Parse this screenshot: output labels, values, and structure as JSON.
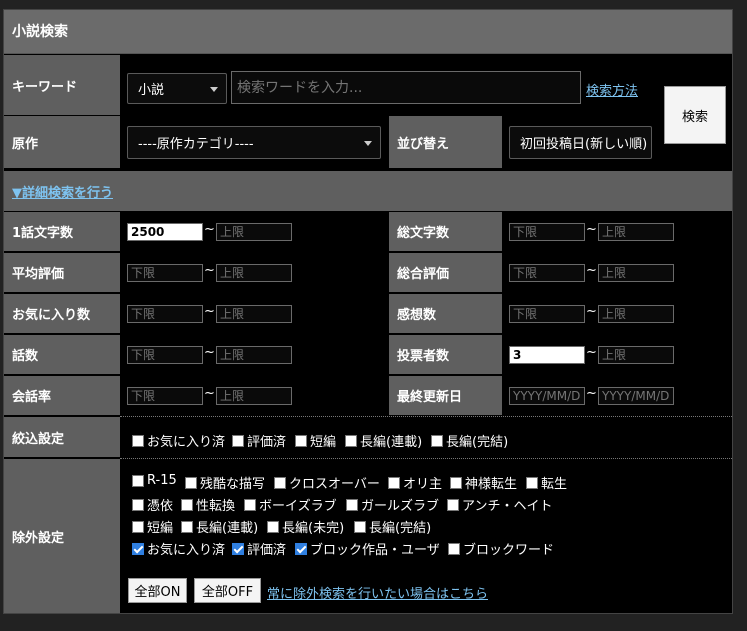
{
  "title": "小説検索",
  "keyword": {
    "label": "キーワード",
    "type_select": "小説",
    "placeholder": "検索ワードを入力...",
    "help_link": "検索方法",
    "search_button": "検索"
  },
  "original": {
    "label": "原作",
    "select": "----原作カテゴリ----"
  },
  "sort": {
    "label": "並び替え",
    "select": "初回投稿日(新しい順)"
  },
  "advanced_toggle": "▼詳細検索を行う",
  "ranges": {
    "tilde": "~",
    "words_per_chapter": {
      "label": "1話文字数",
      "min": "2500",
      "max_placeholder": "上限"
    },
    "total_words": {
      "label": "総文字数",
      "min_placeholder": "下限",
      "max_placeholder": "上限"
    },
    "avg_rating": {
      "label": "平均評価",
      "min_placeholder": "下限",
      "max_placeholder": "上限"
    },
    "total_rating": {
      "label": "総合評価",
      "min_placeholder": "下限",
      "max_placeholder": "上限"
    },
    "favorites": {
      "label": "お気に入り数",
      "min_placeholder": "下限",
      "max_placeholder": "上限"
    },
    "reviews": {
      "label": "感想数",
      "min_placeholder": "下限",
      "max_placeholder": "上限"
    },
    "chapters": {
      "label": "話数",
      "min_placeholder": "下限",
      "max_placeholder": "上限"
    },
    "voters": {
      "label": "投票者数",
      "min": "3",
      "max_placeholder": "上限"
    },
    "dialogue_rate": {
      "label": "会話率",
      "min_placeholder": "下限",
      "max_placeholder": "上限"
    },
    "last_update": {
      "label": "最終更新日",
      "min_placeholder": "YYYY/MM/DD",
      "max_placeholder": "YYYY/MM/DD"
    }
  },
  "filter": {
    "label": "絞込設定",
    "options": [
      {
        "label": "お気に入り済",
        "checked": false
      },
      {
        "label": "評価済",
        "checked": false
      },
      {
        "label": "短編",
        "checked": false
      },
      {
        "label": "長編(連載)",
        "checked": false
      },
      {
        "label": "長編(完結)",
        "checked": false
      }
    ]
  },
  "exclude": {
    "label": "除外設定",
    "rows": [
      [
        {
          "label": "R-15",
          "checked": false
        },
        {
          "label": "残酷な描写",
          "checked": false
        },
        {
          "label": "クロスオーバー",
          "checked": false
        },
        {
          "label": "オリ主",
          "checked": false
        },
        {
          "label": "神様転生",
          "checked": false
        },
        {
          "label": "転生",
          "checked": false
        }
      ],
      [
        {
          "label": "憑依",
          "checked": false
        },
        {
          "label": "性転換",
          "checked": false
        },
        {
          "label": "ボーイズラブ",
          "checked": false
        },
        {
          "label": "ガールズラブ",
          "checked": false
        },
        {
          "label": "アンチ・ヘイト",
          "checked": false
        }
      ],
      [
        {
          "label": "短編",
          "checked": false
        },
        {
          "label": "長編(連載)",
          "checked": false
        },
        {
          "label": "長編(未完)",
          "checked": false
        },
        {
          "label": "長編(完結)",
          "checked": false
        }
      ],
      [
        {
          "label": "お気に入り済",
          "checked": true
        },
        {
          "label": "評価済",
          "checked": true
        },
        {
          "label": "ブロック作品・ユーザ",
          "checked": true
        },
        {
          "label": "ブロックワード",
          "checked": false
        }
      ]
    ],
    "all_on": "全部ON",
    "all_off": "全部OFF",
    "always_link": "常に除外検索を行いたい場合はこちら"
  }
}
